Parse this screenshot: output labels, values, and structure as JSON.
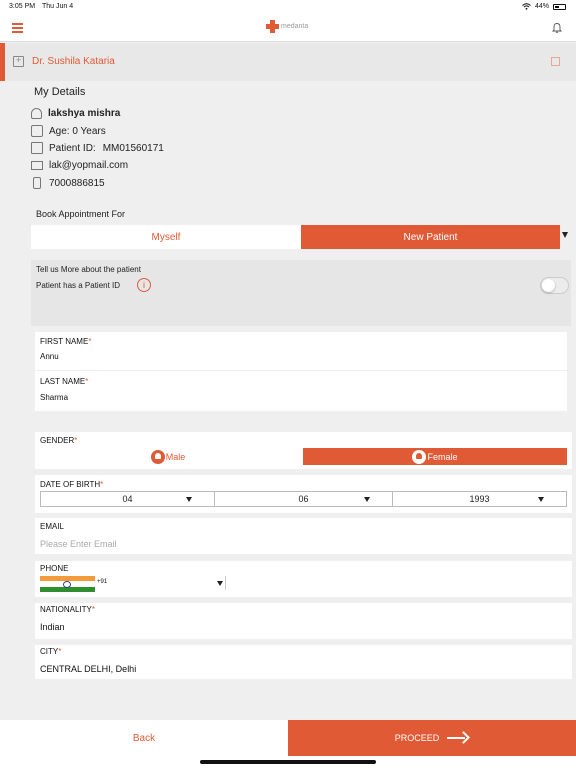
{
  "status_bar": {
    "time": "3:05 PM",
    "date": "Thu Jun 4",
    "battery": "44%"
  },
  "nav": {
    "logo_text": "medanta"
  },
  "doctor": {
    "name": "Dr. Sushila Kataria"
  },
  "my_details": {
    "title": "My Details",
    "name": "lakshya mishra",
    "age": "Age: 0 Years",
    "patient_id_label": "Patient ID:",
    "patient_id_value": "MM01560171",
    "email": "lak@yopmail.com",
    "phone": "7000886815"
  },
  "book_for": {
    "label": "Book Appointment For",
    "options": [
      "Myself",
      "New Patient"
    ],
    "selected": "New Patient"
  },
  "tell_more": {
    "title": "Tell us More about the patient",
    "has_id_label": "Patient has a Patient ID",
    "info_glyph": "i",
    "has_id_enabled": false
  },
  "form": {
    "first_name": {
      "label": "FIRST NAME",
      "value": "Annu"
    },
    "last_name": {
      "label": "LAST NAME",
      "value": "Sharma"
    },
    "gender": {
      "label": "GENDER",
      "options": [
        "Male",
        "Female"
      ],
      "selected": "Female"
    },
    "dob": {
      "label": "DATE OF BIRTH",
      "day": "04",
      "month": "06",
      "year": "1993"
    },
    "email": {
      "label": "EMAIL",
      "placeholder": "Please Enter Email",
      "value": ""
    },
    "phone": {
      "label": "PHONE",
      "dial_code": "+91",
      "value": ""
    },
    "nationality": {
      "label": "NATIONALITY",
      "value": "Indian"
    },
    "city": {
      "label": "CITY",
      "value": "CENTRAL DELHI, Delhi"
    },
    "required_mark": "*"
  },
  "footer": {
    "back": "Back",
    "proceed": "PROCEED"
  },
  "colors": {
    "accent": "#e05a35",
    "background": "#efefef",
    "card": "#ffffff"
  },
  "icons": [
    "hamburger-icon",
    "medanta-logo-icon",
    "bell-icon",
    "doctor-icon",
    "edit-icon",
    "user-icon",
    "age-icon",
    "id-card-icon",
    "mail-icon",
    "phone-icon",
    "info-icon",
    "male-icon",
    "female-icon",
    "india-flag-icon",
    "arrow-right-icon"
  ]
}
